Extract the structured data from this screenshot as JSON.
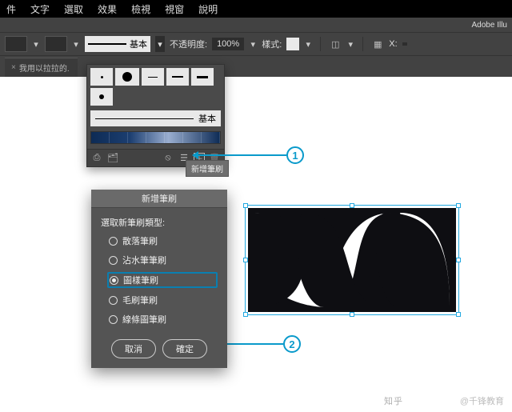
{
  "menubar": {
    "items": [
      "件",
      "文字",
      "選取",
      "效果",
      "檢視",
      "視窗",
      "說明"
    ]
  },
  "appbar": {
    "title": "Adobe Illu"
  },
  "ctrlbar": {
    "stroke_preset": "基本",
    "opacity_label": "不透明度:",
    "opacity_value": "100%",
    "style_label": "樣式:",
    "x_label": "X:"
  },
  "tab": {
    "title": "我用以拉拉的.",
    "close": "×"
  },
  "brushes": {
    "basic_label": "基本",
    "tooltip": "新增筆刷"
  },
  "dialog": {
    "title": "新增筆刷",
    "prompt": "選取新筆刷類型:",
    "options": [
      "散落筆刷",
      "沾水筆筆刷",
      "圖樣筆刷",
      "毛刷筆刷",
      "線條圖筆刷"
    ],
    "selected_index": 2,
    "cancel": "取消",
    "ok": "確定"
  },
  "callouts": {
    "one": "1",
    "two": "2"
  },
  "watermark": {
    "zhihu": "知乎",
    "org": "@千锋教育"
  }
}
